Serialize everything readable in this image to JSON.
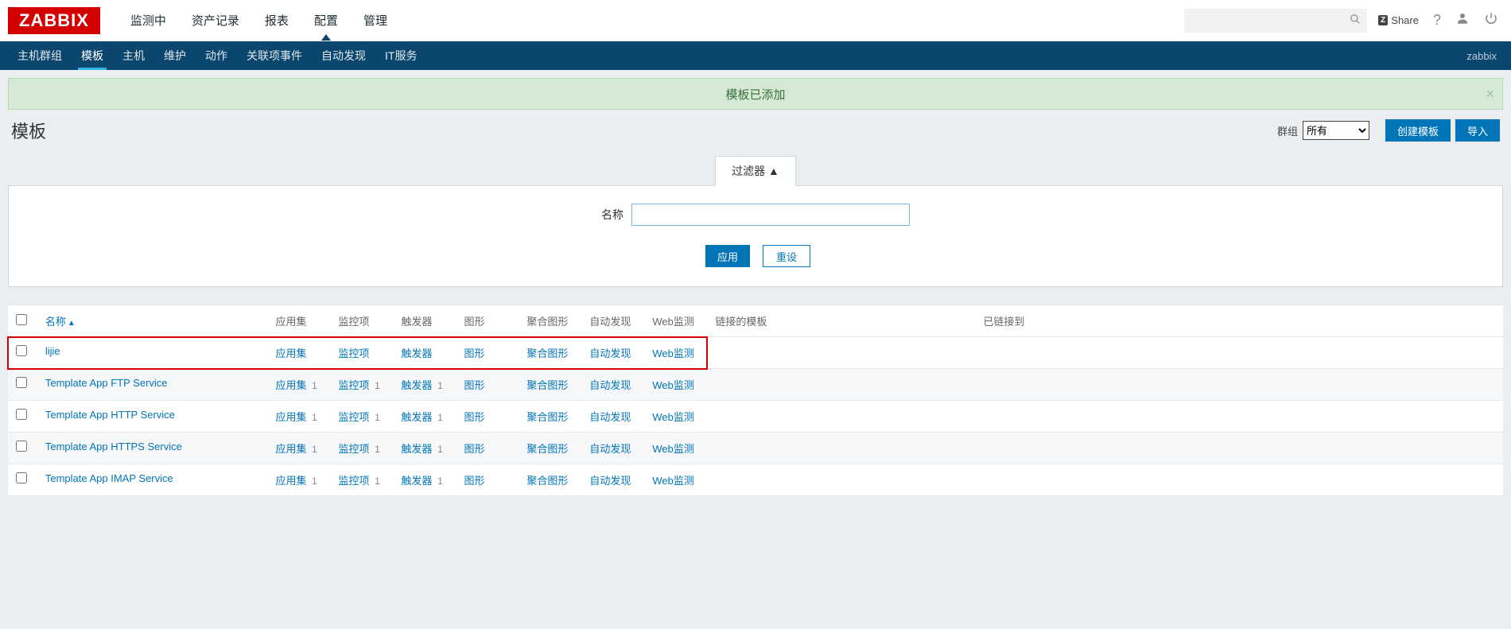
{
  "logo": "ZABBIX",
  "main_nav": {
    "items": [
      "监测中",
      "资产记录",
      "报表",
      "配置",
      "管理"
    ],
    "active_index": 3
  },
  "sub_nav": {
    "items": [
      "主机群组",
      "模板",
      "主机",
      "维护",
      "动作",
      "关联项事件",
      "自动发现",
      "IT服务"
    ],
    "active_index": 1,
    "user": "zabbix"
  },
  "share_label": "Share",
  "banner": {
    "text": "模板已添加"
  },
  "page": {
    "title": "模板",
    "group_label": "群组",
    "group_value": "所有",
    "create_btn": "创建模板",
    "import_btn": "导入"
  },
  "filter": {
    "tab": "过滤器 ▲",
    "name_label": "名称",
    "name_value": "",
    "apply": "应用",
    "reset": "重设"
  },
  "table": {
    "headers": {
      "name": "名称",
      "apps": "应用集",
      "items": "监控项",
      "triggers": "触发器",
      "graphs": "图形",
      "screens": "聚合图形",
      "discovery": "自动发现",
      "web": "Web监测",
      "linked_tpl": "链接的模板",
      "linked_to": "已链接到"
    },
    "rows": [
      {
        "name": "lijie",
        "highlight": true,
        "apps": {
          "label": "应用集",
          "count": null
        },
        "items": {
          "label": "监控项",
          "count": null
        },
        "triggers": {
          "label": "触发器",
          "count": null
        },
        "graphs": {
          "label": "图形",
          "count": null
        },
        "screens": {
          "label": "聚合图形",
          "count": null
        },
        "discovery": {
          "label": "自动发现",
          "count": null
        },
        "web": {
          "label": "Web监测",
          "count": null
        },
        "linked_tpl": "",
        "linked_to": ""
      },
      {
        "name": "Template App FTP Service",
        "apps": {
          "label": "应用集",
          "count": 1
        },
        "items": {
          "label": "监控项",
          "count": 1
        },
        "triggers": {
          "label": "触发器",
          "count": 1
        },
        "graphs": {
          "label": "图形",
          "count": null
        },
        "screens": {
          "label": "聚合图形",
          "count": null
        },
        "discovery": {
          "label": "自动发现",
          "count": null
        },
        "web": {
          "label": "Web监测",
          "count": null
        },
        "linked_tpl": "",
        "linked_to": ""
      },
      {
        "name": "Template App HTTP Service",
        "apps": {
          "label": "应用集",
          "count": 1
        },
        "items": {
          "label": "监控项",
          "count": 1
        },
        "triggers": {
          "label": "触发器",
          "count": 1
        },
        "graphs": {
          "label": "图形",
          "count": null
        },
        "screens": {
          "label": "聚合图形",
          "count": null
        },
        "discovery": {
          "label": "自动发现",
          "count": null
        },
        "web": {
          "label": "Web监测",
          "count": null
        },
        "linked_tpl": "",
        "linked_to": ""
      },
      {
        "name": "Template App HTTPS Service",
        "apps": {
          "label": "应用集",
          "count": 1
        },
        "items": {
          "label": "监控项",
          "count": 1
        },
        "triggers": {
          "label": "触发器",
          "count": 1
        },
        "graphs": {
          "label": "图形",
          "count": null
        },
        "screens": {
          "label": "聚合图形",
          "count": null
        },
        "discovery": {
          "label": "自动发现",
          "count": null
        },
        "web": {
          "label": "Web监测",
          "count": null
        },
        "linked_tpl": "",
        "linked_to": ""
      },
      {
        "name": "Template App IMAP Service",
        "apps": {
          "label": "应用集",
          "count": 1
        },
        "items": {
          "label": "监控项",
          "count": 1
        },
        "triggers": {
          "label": "触发器",
          "count": 1
        },
        "graphs": {
          "label": "图形",
          "count": null
        },
        "screens": {
          "label": "聚合图形",
          "count": null
        },
        "discovery": {
          "label": "自动发现",
          "count": null
        },
        "web": {
          "label": "Web监测",
          "count": null
        },
        "linked_tpl": "",
        "linked_to": ""
      }
    ]
  }
}
